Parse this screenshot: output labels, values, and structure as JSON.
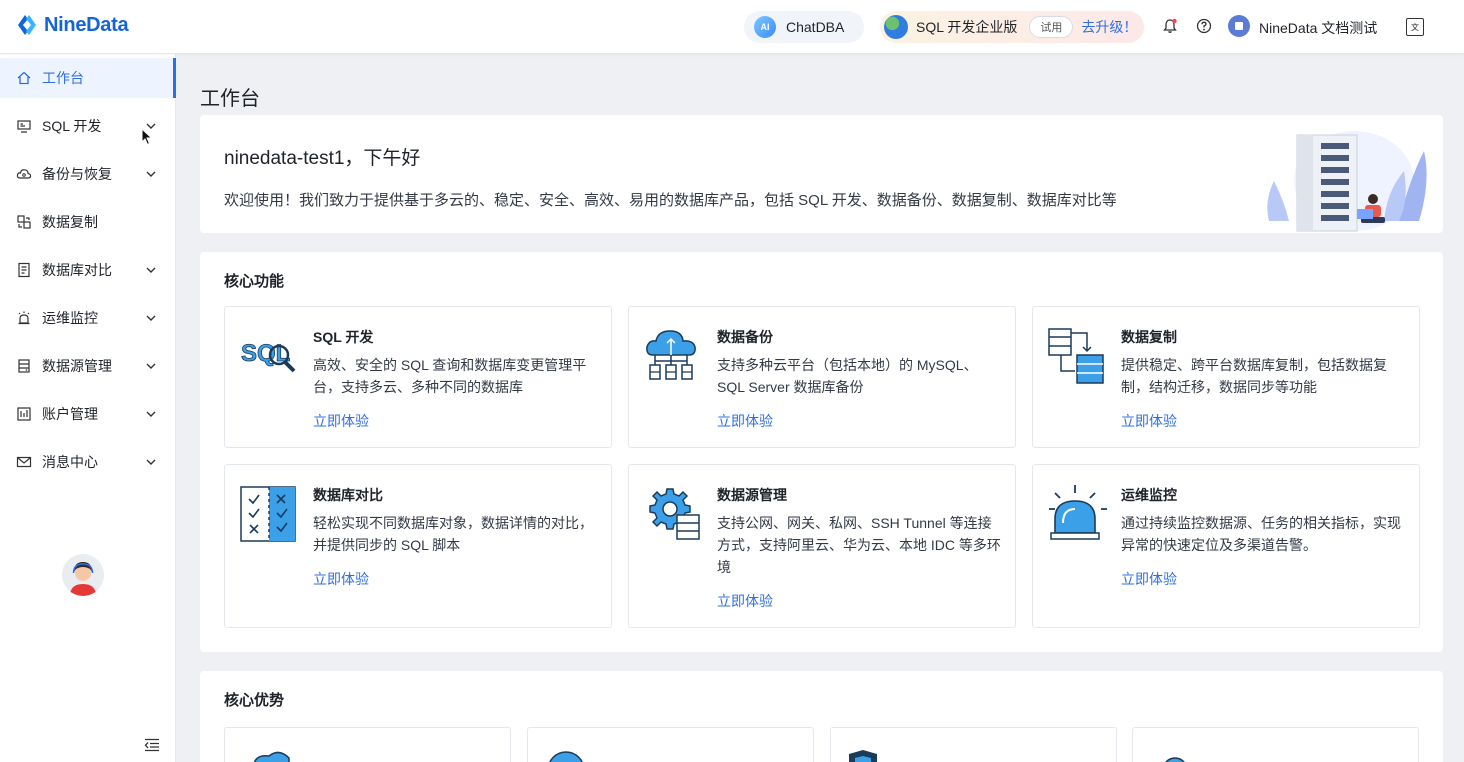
{
  "brand": {
    "name": "NineData",
    "color": "#1565d8"
  },
  "header": {
    "chatdba_badge": "AI",
    "chatdba_label": "ChatDBA",
    "edition_label": "SQL 开发企业版",
    "trial_label": "试用",
    "upgrade_label": "去升级！",
    "user_name": "NineData 文档测试",
    "icons": [
      "bell-icon",
      "help-icon",
      "language-icon"
    ]
  },
  "sidebar": {
    "items": [
      {
        "label": "工作台",
        "icon": "home-icon",
        "active": true,
        "expandable": false
      },
      {
        "label": "SQL 开发",
        "icon": "monitor-icon",
        "expandable": true
      },
      {
        "label": "备份与恢复",
        "icon": "cloud-icon",
        "expandable": true
      },
      {
        "label": "数据复制",
        "icon": "copy-icon",
        "expandable": false
      },
      {
        "label": "数据库对比",
        "icon": "compare-icon",
        "expandable": true
      },
      {
        "label": "运维监控",
        "icon": "alarm-icon",
        "expandable": true
      },
      {
        "label": "数据源管理",
        "icon": "database-icon",
        "expandable": true
      },
      {
        "label": "账户管理",
        "icon": "account-icon",
        "expandable": true
      },
      {
        "label": "消息中心",
        "icon": "mail-icon",
        "expandable": true
      }
    ]
  },
  "main": {
    "page_title": "工作台",
    "welcome": {
      "greeting": "ninedata-test1，下午好",
      "intro": "欢迎使用！我们致力于提供基于多云的、稳定、安全、高效、易用的数据库产品，包括 SQL 开发、数据备份、数据复制、数据库对比等"
    },
    "core_features": {
      "title": "核心功能",
      "cards": [
        {
          "title": "SQL 开发",
          "desc": "高效、安全的 SQL 查询和数据库变更管理平台，支持多云、多种不同的数据库",
          "link": "立即体验",
          "icon": "sql-icon"
        },
        {
          "title": "数据备份",
          "desc": "支持多种云平台（包括本地）的 MySQL、SQL Server 数据库备份",
          "link": "立即体验",
          "icon": "cloud-backup-icon"
        },
        {
          "title": "数据复制",
          "desc": "提供稳定、跨平台数据库复制，包括数据复制，结构迁移，数据同步等功能",
          "link": "立即体验",
          "icon": "replication-icon"
        },
        {
          "title": "数据库对比",
          "desc": "轻松实现不同数据库对象，数据详情的对比，并提供同步的 SQL 脚本",
          "link": "立即体验",
          "icon": "checklist-icon"
        },
        {
          "title": "数据源管理",
          "desc": "支持公网、网关、私网、SSH Tunnel 等连接方式，支持阿里云、华为云、本地 IDC 等多环境",
          "link": "立即体验",
          "icon": "gear-database-icon"
        },
        {
          "title": "运维监控",
          "desc": "通过持续监控数据源、任务的相关指标，实现异常的快速定位及多渠道告警。",
          "link": "立即体验",
          "icon": "alarm-light-icon"
        }
      ]
    },
    "core_advantages": {
      "title": "核心优势"
    }
  },
  "colors": {
    "accent": "#2f6fe4",
    "active_bg": "#eef4ff",
    "icon_blue": "#3ba0e8"
  }
}
